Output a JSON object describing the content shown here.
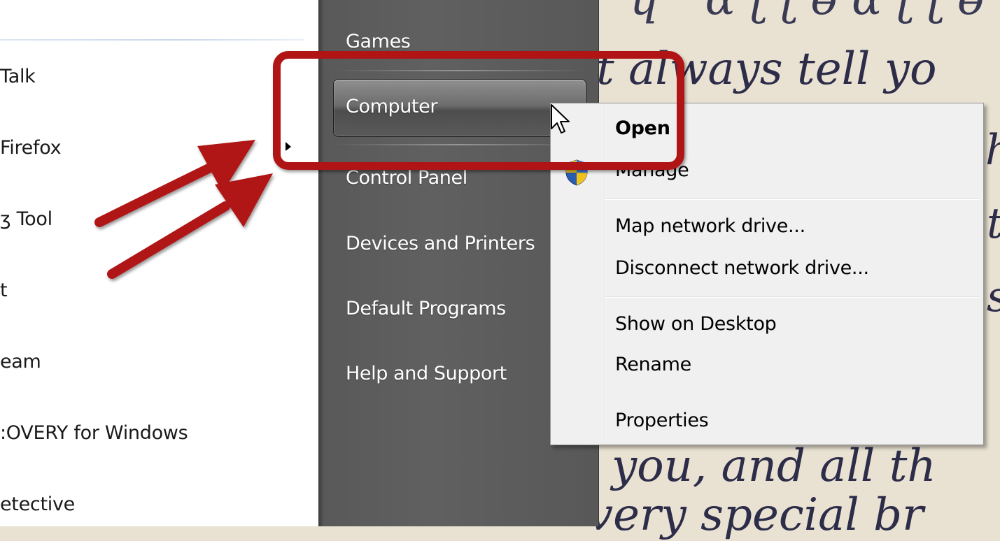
{
  "left_list": {
    "items": [
      {
        "label": "Talk"
      },
      {
        "label": "Firefox"
      },
      {
        "label": "ʒ Tool"
      },
      {
        "label": "t"
      },
      {
        "label": "eam"
      },
      {
        "label": ":OVERY for Windows"
      },
      {
        "label": "etective"
      }
    ]
  },
  "right_column": {
    "items": [
      {
        "label": "Games"
      },
      {
        "label": "Computer"
      },
      {
        "label": "Control Panel"
      },
      {
        "label": "Devices and Printers"
      },
      {
        "label": "Default Programs"
      },
      {
        "label": "Help and Support"
      }
    ],
    "selected_item": "Computer"
  },
  "context_menu": {
    "items": [
      {
        "label": "Open",
        "bold": true
      },
      {
        "label": "Manage",
        "icon": "uac-shield-icon"
      },
      {
        "label": "Map network drive..."
      },
      {
        "label": "Disconnect network drive..."
      },
      {
        "label": "Show on Desktop"
      },
      {
        "label": "Rename"
      },
      {
        "label": "Properties"
      }
    ]
  },
  "wallpaper": {
    "lines": [
      "t always tell yo",
      "you, and all th",
      "very special br"
    ]
  },
  "annotation": {
    "highlight_color": "#b01414",
    "arrow_color": "#b01414"
  }
}
